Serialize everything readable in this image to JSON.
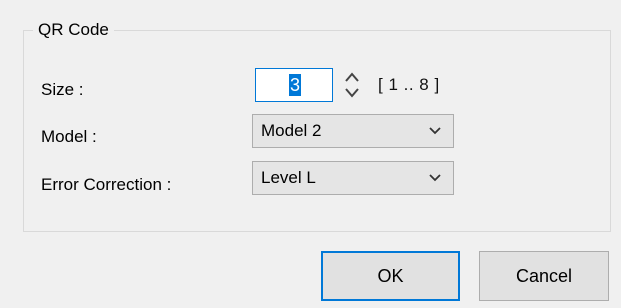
{
  "group": {
    "title": "QR Code"
  },
  "size": {
    "label": "Size :",
    "value": "3",
    "range_hint": "[ 1 .. 8 ]"
  },
  "model": {
    "label": "Model :",
    "selected": "Model 2"
  },
  "error_correction": {
    "label": "Error Correction :",
    "selected": "Level L"
  },
  "buttons": {
    "ok": "OK",
    "cancel": "Cancel"
  },
  "colors": {
    "accent": "#0078d7",
    "background": "#f0f0f0",
    "combo_bg": "#e5e5e5",
    "button_bg": "#e1e1e1"
  },
  "icons": {
    "spinner": "updown-spinner-icon",
    "dropdown": "chevron-down-icon"
  }
}
